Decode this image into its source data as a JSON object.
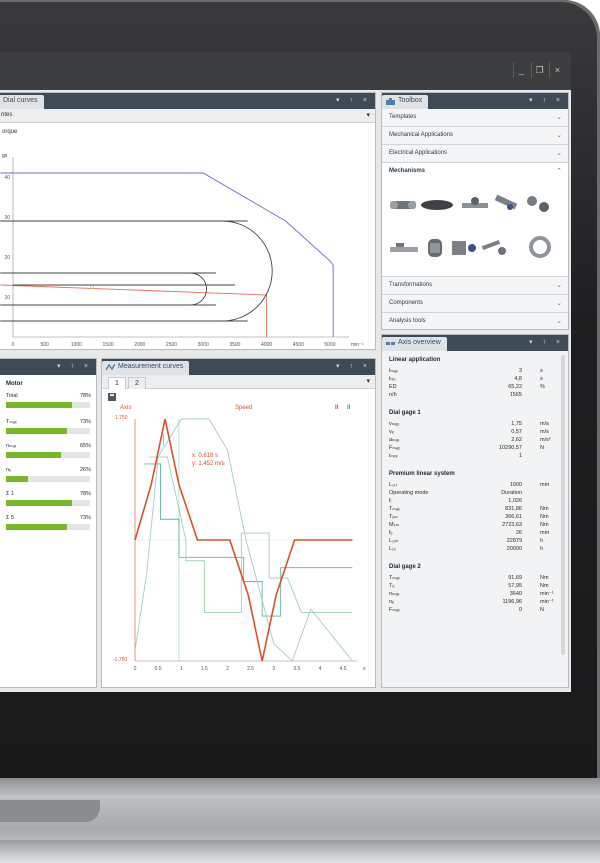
{
  "window": {
    "controls": [
      "_",
      "❐",
      "×"
    ]
  },
  "panel_controls": "▾ ↑ ×",
  "dial_curves": {
    "tab": "Dial curves",
    "tab_row": "ntes",
    "label": "orque",
    "ylabel": "gs",
    "x_ticks": [
      "0",
      "500",
      "1000",
      "1500",
      "2000",
      "2500",
      "3000",
      "3500",
      "4000",
      "4500",
      "5000"
    ],
    "x_unit": "min⁻¹",
    "y_ticks": [
      "40",
      "30",
      "20",
      "10"
    ],
    "chart_data": {
      "type": "line",
      "xlim": [
        0,
        5300
      ],
      "ylim": [
        0,
        45
      ],
      "series": [
        {
          "color": "#6f6ad8",
          "x": [
            -200,
            3000,
            4300,
            5000,
            5050,
            5050
          ],
          "y": [
            41,
            41,
            29,
            19,
            18,
            0
          ]
        },
        {
          "color": "#e8705f",
          "x": [
            -200,
            4000,
            4000
          ],
          "y": [
            13,
            10.5,
            0
          ]
        },
        {
          "color": "#454545",
          "x": [
            -200,
            3700
          ],
          "y": [
            29,
            29
          ]
        },
        {
          "color": "#454545",
          "x": [
            -200,
            3700
          ],
          "y": [
            4,
            4
          ]
        },
        {
          "color": "#454545",
          "x": [
            -200,
            3200
          ],
          "y": [
            16,
            16
          ]
        },
        {
          "color": "#454545",
          "x": [
            -200,
            3200
          ],
          "y": [
            8,
            8
          ]
        },
        {
          "color": "#454545",
          "x": [
            0,
            3500
          ],
          "y": [
            13,
            13
          ]
        }
      ]
    }
  },
  "toolbox": {
    "tab": "Toolbox",
    "rows": [
      {
        "label": "Templates"
      },
      {
        "label": "Mechanical Applications"
      },
      {
        "label": "Electrical Applications"
      }
    ],
    "mechanisms": "Mechanisms",
    "rows_bottom": [
      {
        "label": "Transformations"
      },
      {
        "label": "Components"
      },
      {
        "label": "Analysis tools"
      }
    ]
  },
  "utilization": {
    "heading": "Motor",
    "rows": [
      {
        "label": "Total",
        "pct": "78%",
        "value": 0.78
      },
      {
        "label": "Tₘₐₓ",
        "pct": "73%",
        "value": 0.73
      },
      {
        "label": "nₘₐₓ",
        "pct": "65%",
        "value": 0.65
      },
      {
        "label": "nₑ",
        "pct": "26%",
        "value": 0.26
      },
      {
        "label": "Σ 1",
        "pct": "78%",
        "value": 0.78
      },
      {
        "label": "Σ 5",
        "pct": "73%",
        "value": 0.73
      }
    ]
  },
  "measurement": {
    "tab": "Measurement curves",
    "subtabs": [
      "1",
      "2"
    ],
    "label_left": "Axis",
    "label_speed": "Speed",
    "legend_marks": [
      "II",
      "II"
    ],
    "annot_1": "x: 0.618 s",
    "annot_2": "y: 1.452 m/s",
    "y_top": "1.750",
    "y_bottom": "-1.750",
    "x_ticks": [
      "0",
      "0.5",
      "1",
      "1.5",
      "2",
      "2.5",
      "3",
      "3.5",
      "4",
      "4.5"
    ],
    "x_unit": "s",
    "chart_data": {
      "type": "line",
      "xlim": [
        0,
        4.8
      ],
      "ylim": [
        -1.75,
        1.75
      ],
      "series": [
        {
          "name": "Speed",
          "color": "#d9502a",
          "x": [
            0,
            0.35,
            0.65,
            0.95,
            1.35,
            2.05,
            2.45,
            2.75,
            3.05,
            3.45,
            4.7
          ],
          "y": [
            0,
            0.8,
            1.75,
            0.8,
            0,
            0,
            -0.8,
            -1.75,
            -0.8,
            0,
            0
          ]
        },
        {
          "color": "#a9c9cf",
          "x": [
            0,
            0.25,
            0.5,
            1.0,
            1.6,
            2.0,
            2.4,
            3.0,
            3.4,
            3.8,
            4.7
          ],
          "y": [
            -1.6,
            -0.5,
            1.2,
            1.75,
            1.75,
            1.3,
            0.0,
            -1.5,
            -1.75,
            -1.0,
            -1.75
          ]
        },
        {
          "color": "#9fd3ad",
          "x": [
            0.3,
            0.7,
            1.1,
            1.1,
            1.5,
            1.5,
            2.3,
            2.3,
            2.9,
            2.9,
            3.3,
            3.6,
            4.7
          ],
          "y": [
            1.2,
            1.2,
            0.0,
            -0.3,
            -0.3,
            -1.05,
            -1.05,
            0.1,
            0.1,
            -0.55,
            -0.55,
            -1.05,
            -1.05
          ]
        },
        {
          "color": "#5fb59a",
          "x": [
            0.2,
            0.55,
            0.55,
            0.95,
            0.95,
            1.35,
            1.35,
            2.35,
            2.35,
            2.75,
            2.75,
            3.15,
            3.15,
            4.7
          ],
          "y": [
            1.1,
            1.1,
            0.3,
            0.3,
            -0.25,
            -0.25,
            -0.25,
            -0.25,
            -0.6,
            -0.6,
            -1.1,
            -1.1,
            -0.4,
            -0.4
          ]
        }
      ]
    }
  },
  "axis_overview": {
    "tab": "Axis overview",
    "sections": [
      {
        "title": "Linear application",
        "rows": [
          {
            "label": "tₘₐₓ",
            "value": "3",
            "unit": "s"
          },
          {
            "label": "tᵣₑₛ",
            "value": "4,8",
            "unit": "s"
          },
          {
            "label": "ED",
            "value": "65,22",
            "unit": "%"
          },
          {
            "label": "n/h",
            "value": "1565",
            "unit": ""
          }
        ]
      },
      {
        "title": "Dial gage 1",
        "rows": [
          {
            "label": "vₘₐₓ",
            "value": "1,75",
            "unit": "m/s"
          },
          {
            "label": "vₑ",
            "value": "0,57",
            "unit": "m/s"
          },
          {
            "label": "aₘₐₓ",
            "value": "2,62",
            "unit": "m/s²"
          },
          {
            "label": "Fₘₐₓ",
            "value": "10290,57",
            "unit": "N"
          },
          {
            "label": "iₘₑₓ",
            "value": "1",
            "unit": ""
          }
        ]
      },
      {
        "title": "Premium linear system",
        "rows": [
          {
            "label": "Lₛₜᵣ",
            "value": "1000",
            "unit": "mm"
          },
          {
            "label": "Operating mode",
            "value": "Duration",
            "unit": ""
          },
          {
            "label": "fᵢ",
            "value": "1,026",
            "unit": ""
          },
          {
            "label": "Tₘₐₓ",
            "value": "831,86",
            "unit": "Nm"
          },
          {
            "label": "Tₑₘ",
            "value": "366,61",
            "unit": "Nm"
          },
          {
            "label": "Mₖₘ",
            "value": "2723,63",
            "unit": "Nm"
          },
          {
            "label": "fₑ",
            "value": "26",
            "unit": "mm"
          },
          {
            "label": "L₁₀ₕ",
            "value": "22879",
            "unit": "h"
          },
          {
            "label": "L₁₀",
            "value": "20000",
            "unit": "h"
          }
        ]
      },
      {
        "title": "Dial gage 2",
        "rows": [
          {
            "label": "Tₘₐₓ",
            "value": "91,69",
            "unit": "Nm"
          },
          {
            "label": "Tₑ",
            "value": "57,95",
            "unit": "Nm"
          },
          {
            "label": "nₘₐₓ",
            "value": "3640",
            "unit": "min⁻¹"
          },
          {
            "label": "nₑ",
            "value": "1196,96",
            "unit": "min⁻¹"
          },
          {
            "label": "Fₘₐₓ",
            "value": "0",
            "unit": "N"
          }
        ]
      }
    ]
  }
}
